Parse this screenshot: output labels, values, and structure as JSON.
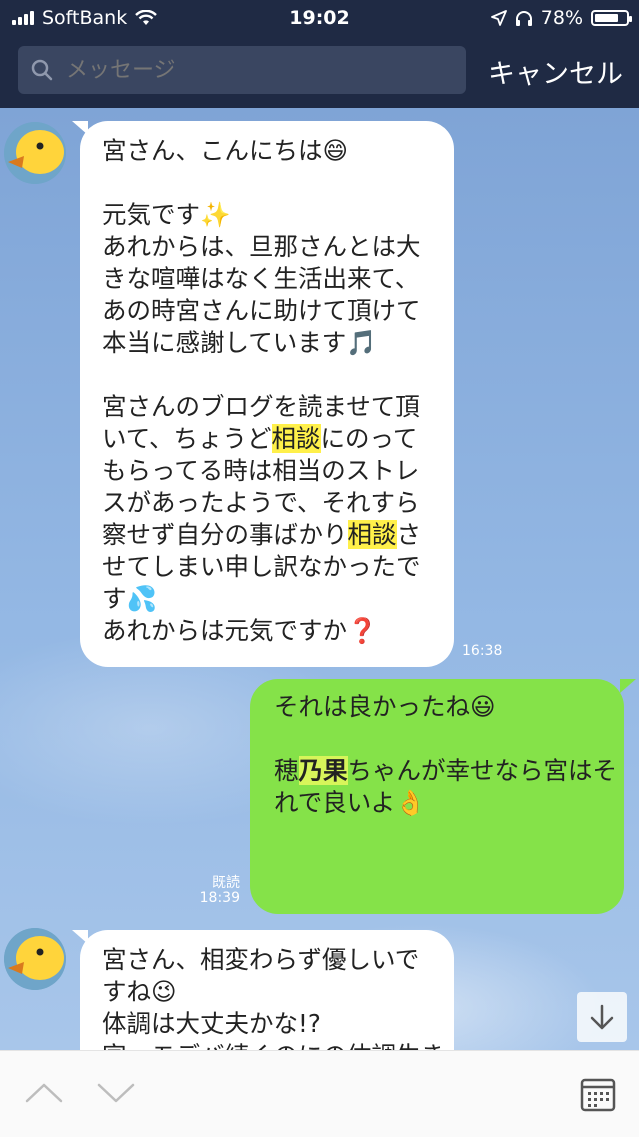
{
  "status_bar": {
    "carrier": "SoftBank",
    "time": "19:02",
    "battery_percent": "78%",
    "battery_level": 0.78,
    "icons": [
      "signal-bars-icon",
      "wifi-icon",
      "location-arrow-icon",
      "headphones-icon",
      "battery-icon"
    ]
  },
  "search": {
    "placeholder": "メッセージ",
    "cancel_label": "キャンセル"
  },
  "messages": [
    {
      "direction": "incoming",
      "lines": [
        "宮さん、こんにちは😄",
        "",
        "元気です✨",
        "あれからは、旦那さんとは大",
        "きな喧嘩はなく生活出来て、",
        "あの時宮さんに助けて頂けて",
        "本当に感謝しています🎵",
        "",
        "宮さんのブログを読ませて頂",
        "いて、ちょうど相談にのって",
        "もらってる時は相当のストレ",
        "スがあったようで、それすら",
        "察せず自分の事ばかり相談さ",
        "せてしまい申し訳なかったで",
        "す💦",
        "あれからは元気ですか❓"
      ],
      "highlight": "相談",
      "time": "16:38"
    },
    {
      "direction": "outgoing",
      "lines": [
        "それは良かったね😃",
        "",
        "穂乃果ちゃんが幸せなら宮はそ",
        "れで良いよ👌"
      ],
      "highlight": "乃果",
      "read_label": "既読",
      "time": "18:39"
    },
    {
      "direction": "incoming",
      "lines": [
        "宮さん、相変わらず優しいで",
        "すね😉",
        "体調は大丈夫かな!?",
        "宮、モデバ続くのにの体調生き"
      ]
    }
  ],
  "bottom_bar": {
    "icons": [
      "chevron-up-icon",
      "chevron-down-icon",
      "calendar-icon"
    ]
  },
  "colors": {
    "header_bg": "#1f2a44",
    "incoming_bubble": "#ffffff",
    "outgoing_bubble": "#85e249",
    "highlight": "#fff04a"
  }
}
